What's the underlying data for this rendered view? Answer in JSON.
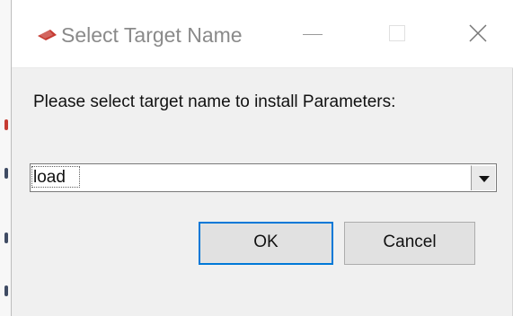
{
  "window": {
    "title": "Select Target Name",
    "icon": "app-logo-icon",
    "controls": {
      "minimize": "minimize-icon",
      "maximize": "maximize-icon",
      "close": "close-icon"
    }
  },
  "dialog": {
    "prompt": "Please select target name to install Parameters:",
    "target_select": {
      "selected_value": "load",
      "icon": "chevron-down-icon"
    },
    "buttons": {
      "ok_label": "OK",
      "cancel_label": "Cancel"
    }
  },
  "colors": {
    "accent": "#0078d7",
    "logo": "#c63b32",
    "title_text": "#8a8a8a",
    "dialog_bg": "#f0f0f0",
    "button_bg": "#e1e1e1"
  }
}
